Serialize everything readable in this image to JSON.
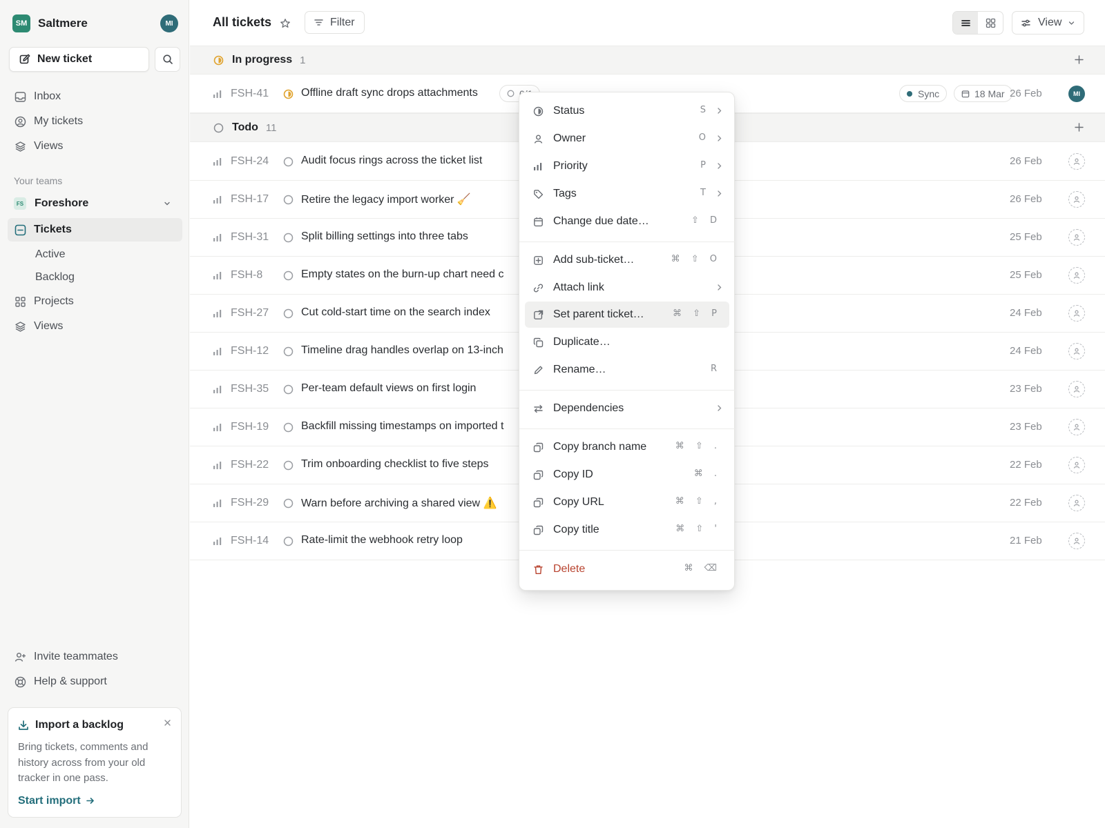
{
  "workspace": {
    "initials": "SM",
    "name": "Saltmere",
    "user_initials": "MI"
  },
  "sidebar": {
    "new_ticket_label": "New ticket",
    "nav": [
      {
        "label": "Inbox",
        "icon": "inbox-icon"
      },
      {
        "label": "My tickets",
        "icon": "user-circle-icon"
      },
      {
        "label": "Views",
        "icon": "layers-icon"
      }
    ],
    "section_label": "Your teams",
    "team": {
      "badge": "FS",
      "name": "Foreshore"
    },
    "tickets_label": "Tickets",
    "sub_items": [
      "Active",
      "Backlog"
    ],
    "projects_label": "Projects",
    "views_label": "Views",
    "footer": [
      {
        "label": "Invite teammates",
        "icon": "user-plus-icon"
      },
      {
        "label": "Help & support",
        "icon": "lifebuoy-icon"
      }
    ],
    "import_card": {
      "title": "Import a backlog",
      "body": "Bring tickets, comments and history across from your old tracker in one pass.",
      "link": "Start import"
    }
  },
  "header": {
    "title": "All tickets",
    "filter_label": "Filter",
    "view_label": "View"
  },
  "groups": {
    "in_progress": {
      "name": "In progress",
      "count": "1"
    },
    "todo": {
      "name": "Todo",
      "count": "11"
    }
  },
  "in_progress_rows": [
    {
      "id": "FSH-41",
      "title": "Offline draft sync drops attachments",
      "subcount": "0/1",
      "label": "Sync",
      "due": "18 Mar",
      "date": "26 Feb",
      "assignee": "MI"
    }
  ],
  "todo_rows": [
    {
      "id": "FSH-24",
      "title": "Audit focus rings across the ticket list",
      "date": "26 Feb"
    },
    {
      "id": "FSH-17",
      "title": "Retire the legacy import worker 🧹",
      "date": "26 Feb"
    },
    {
      "id": "FSH-31",
      "title": "Split billing settings into three tabs",
      "date": "25 Feb"
    },
    {
      "id": "FSH-8",
      "title": "Empty states on the burn-up chart need c",
      "date": "25 Feb"
    },
    {
      "id": "FSH-27",
      "title": "Cut cold-start time on the search index",
      "date": "24 Feb"
    },
    {
      "id": "FSH-12",
      "title": "Timeline drag handles overlap on 13-inch",
      "date": "24 Feb"
    },
    {
      "id": "FSH-35",
      "title": "Per-team default views on first login",
      "date": "23 Feb"
    },
    {
      "id": "FSH-19",
      "title": "Backfill missing timestamps on imported t",
      "date": "23 Feb"
    },
    {
      "id": "FSH-22",
      "title": "Trim onboarding checklist to five steps",
      "date": "22 Feb"
    },
    {
      "id": "FSH-29",
      "title": "Warn before archiving a shared view ⚠️",
      "date": "22 Feb"
    },
    {
      "id": "FSH-14",
      "title": "Rate-limit the webhook retry loop",
      "date": "21 Feb"
    }
  ],
  "context_menu": {
    "items": [
      {
        "label": "Status",
        "shortcut": "S",
        "submenu": true,
        "icon": "half-circle-icon"
      },
      {
        "label": "Owner",
        "shortcut": "O",
        "submenu": true,
        "icon": "person-icon"
      },
      {
        "label": "Priority",
        "shortcut": "P",
        "submenu": true,
        "icon": "bars-icon"
      },
      {
        "label": "Tags",
        "shortcut": "T",
        "submenu": true,
        "icon": "tag-icon"
      },
      {
        "label": "Change due date…",
        "shortcut": "⇧ D",
        "icon": "calendar-icon"
      },
      {
        "label": "Add sub-ticket…",
        "shortcut": "⌘ ⇧ O",
        "icon": "plus-square-icon"
      },
      {
        "label": "Attach link",
        "shortcut": "",
        "submenu": true,
        "icon": "link-icon"
      },
      {
        "label": "Set parent ticket…",
        "shortcut": "⌘ ⇧ P",
        "icon": "parent-icon",
        "highlighted": true
      },
      {
        "label": "Duplicate…",
        "shortcut": "",
        "icon": "duplicate-icon"
      },
      {
        "label": "Rename…",
        "shortcut": "R",
        "icon": "pencil-icon"
      },
      {
        "label": "Dependencies",
        "shortcut": "",
        "submenu": true,
        "icon": "arrows-icon"
      },
      {
        "label": "Copy branch name",
        "shortcut": "⌘ ⇧ .",
        "icon": "copy-icon"
      },
      {
        "label": "Copy ID",
        "shortcut": "⌘ .",
        "icon": "copy-icon"
      },
      {
        "label": "Copy URL",
        "shortcut": "⌘ ⇧ ,",
        "icon": "copy-icon"
      },
      {
        "label": "Copy title",
        "shortcut": "⌘ ⇧ '",
        "icon": "copy-icon"
      },
      {
        "label": "Delete",
        "shortcut": "⌘ ⌫",
        "icon": "trash-icon",
        "danger": true
      }
    ]
  },
  "colors": {
    "accent": "#2d8a72",
    "avatar": "#2f6c78",
    "in_progress": "#e0a32e",
    "danger": "#b8432f",
    "link": "#236e7b"
  }
}
